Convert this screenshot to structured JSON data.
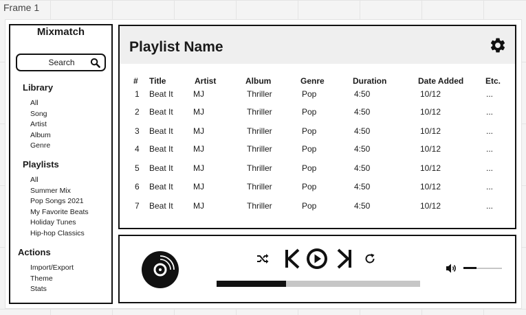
{
  "frame_label": "Frame 1",
  "sidebar": {
    "app_title": "Mixmatch",
    "search": {
      "label": "Search"
    },
    "library": {
      "title": "Library",
      "items": [
        "All",
        "Song",
        "Artist",
        "Album",
        "Genre"
      ]
    },
    "playlists": {
      "title": "Playlists",
      "items": [
        "All",
        "Summer Mix",
        "Pop Songs 2021",
        "My Favorite Beats",
        "Holiday Tunes",
        "Hip-hop Classics"
      ]
    },
    "actions": {
      "title": "Actions",
      "items": [
        "Import/Export",
        "Theme",
        "Stats"
      ]
    }
  },
  "playlist": {
    "name": "Playlist Name",
    "columns": [
      "#",
      "Title",
      "Artist",
      "Album",
      "Genre",
      "Duration",
      "Date Added",
      "Etc."
    ],
    "rows": [
      [
        "1",
        "Beat It",
        "MJ",
        "Thriller",
        "Pop",
        "4:50",
        "10/12",
        "..."
      ],
      [
        "2",
        "Beat It",
        "MJ",
        "Thriller",
        "Pop",
        "4:50",
        "10/12",
        "..."
      ],
      [
        "3",
        "Beat It",
        "MJ",
        "Thriller",
        "Pop",
        "4:50",
        "10/12",
        "..."
      ],
      [
        "4",
        "Beat It",
        "MJ",
        "Thriller",
        "Pop",
        "4:50",
        "10/12",
        "..."
      ],
      [
        "5",
        "Beat It",
        "MJ",
        "Thriller",
        "Pop",
        "4:50",
        "10/12",
        "..."
      ],
      [
        "6",
        "Beat It",
        "MJ",
        "Thriller",
        "Pop",
        "4:50",
        "10/12",
        "..."
      ],
      [
        "7",
        "Beat It",
        "MJ",
        "Thriller",
        "Pop",
        "4:50",
        "10/12",
        "..."
      ]
    ]
  },
  "player": {
    "icons": [
      "disc-icon",
      "shuffle-icon",
      "skip-previous-icon",
      "play-icon",
      "skip-next-icon",
      "repeat-icon",
      "volume-icon"
    ],
    "progress_fraction": 0.34,
    "volume_fraction": 0.34
  },
  "colors": {
    "outline": "#111111",
    "track": "#c6c6c6",
    "header_bg": "#efefef"
  }
}
